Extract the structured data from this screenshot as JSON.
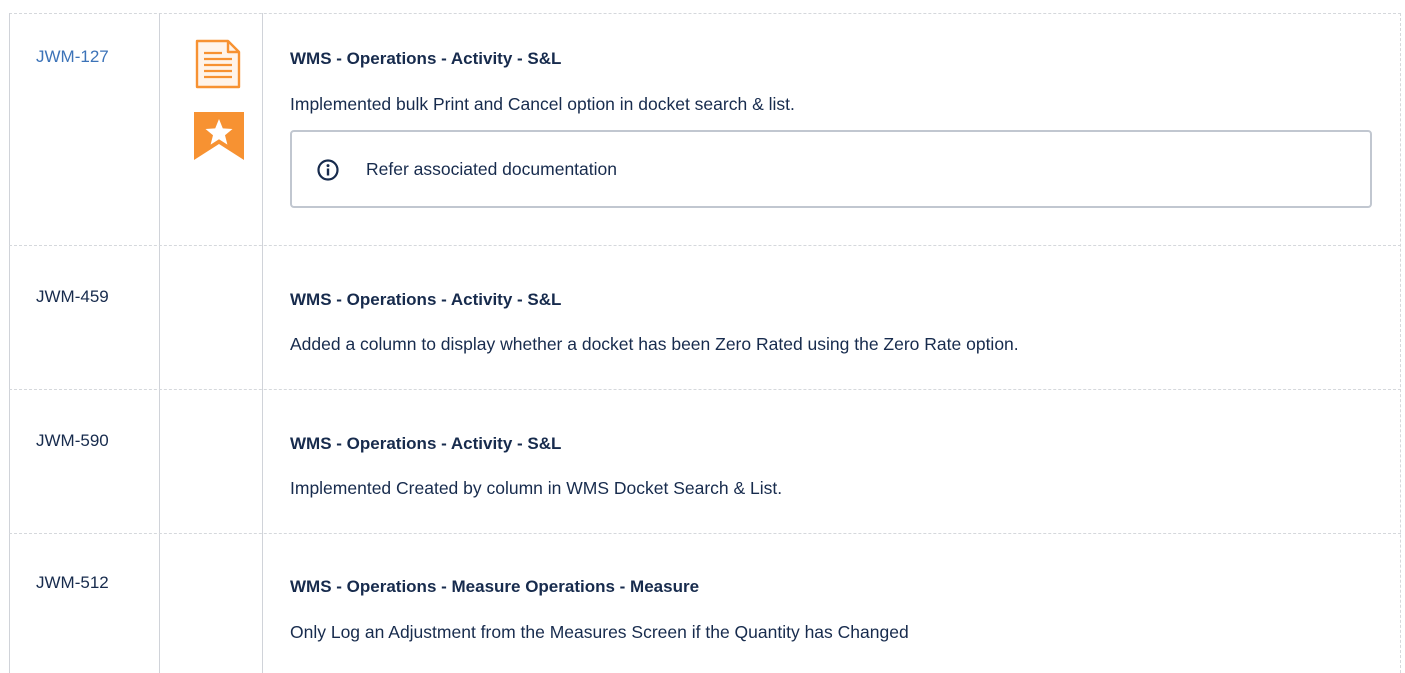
{
  "rows": [
    {
      "key": "JWM-127",
      "summary": "WMS - Operations - Activity - S&L",
      "description": "Implemented bulk Print and Cancel option in docket search & list.",
      "info_panel": "Refer associated documentation",
      "icons": [
        "document-icon",
        "star-icon"
      ]
    },
    {
      "key": "JWM-459",
      "summary": "WMS - Operations - Activity - S&L",
      "description": "Added a column to display whether a docket has been Zero Rated using the Zero Rate option."
    },
    {
      "key": "JWM-590",
      "summary": "WMS - Operations - Activity - S&L",
      "description": "Implemented Created by column in WMS Docket Search & List."
    },
    {
      "key": "JWM-512",
      "summary": "WMS - Operations - Measure Operations - Measure",
      "description": "Only Log an Adjustment from the Measures Screen if the Quantity has Changed"
    }
  ],
  "colors": {
    "link": "#3c73b8",
    "icon_orange": "#f79232",
    "border": "#c1c7d0",
    "text": "#172b4d"
  }
}
